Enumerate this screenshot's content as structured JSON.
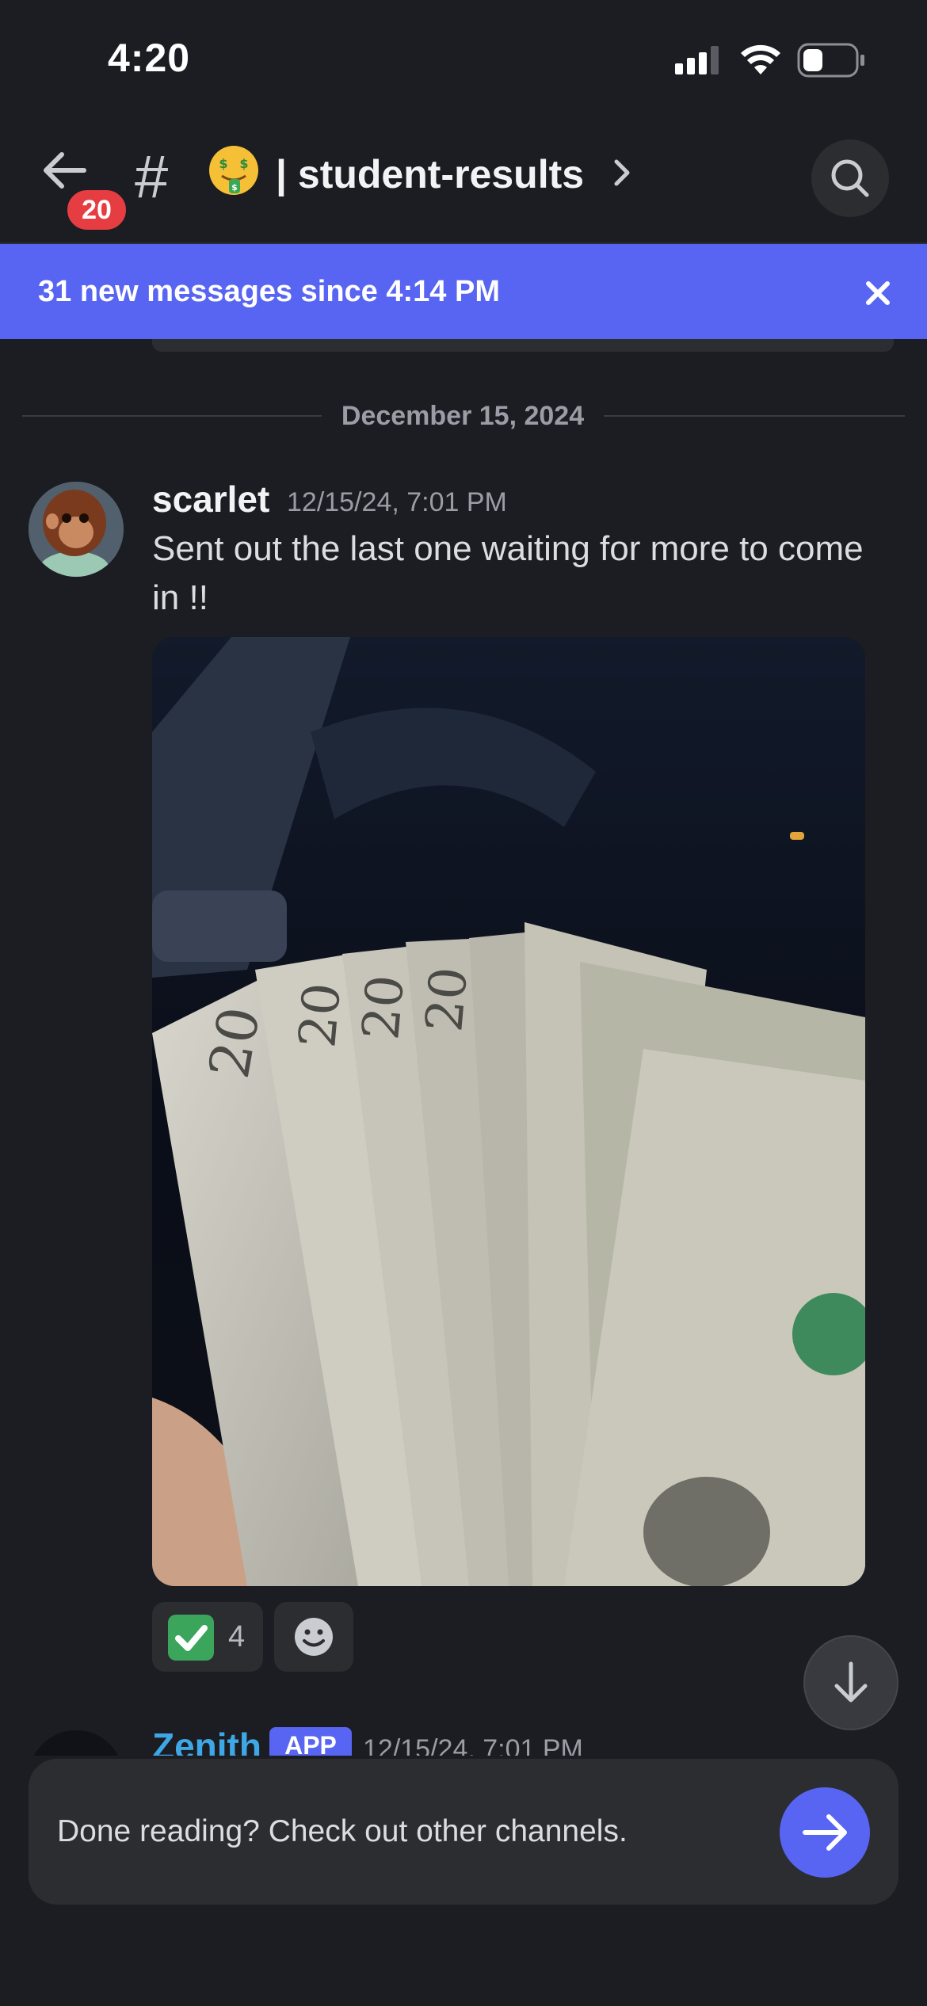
{
  "status_bar": {
    "time": "4:20",
    "icons": [
      "cellular-signal-icon",
      "wifi-icon",
      "battery-icon"
    ]
  },
  "header": {
    "back_icon": "arrow-left-icon",
    "unread_count": "20",
    "channel_icon": "hash-icon",
    "channel_emoji": "money-mouth-face-emoji",
    "channel_name": "| student-results",
    "search_icon": "search-icon"
  },
  "banner": {
    "text": "31 new messages since 4:14 PM",
    "close_icon": "close-icon",
    "color": "#5865f2"
  },
  "date_divider": "December 15, 2024",
  "message": {
    "author": "scarlet",
    "timestamp": "12/15/24, 7:01 PM",
    "text": "Sent out the last one waiting for more to come in !!",
    "attachment": "photo-of-cash-bills",
    "reactions": [
      {
        "emoji": "white-check-mark-emoji",
        "count": "4"
      }
    ],
    "add_reaction_icon": "smiley-face-icon"
  },
  "next_message": {
    "author": "Zenith",
    "badge": "APP",
    "timestamp": "12/15/24, 7:01 PM"
  },
  "jump_to_bottom_icon": "arrow-down-icon",
  "footer_prompt": {
    "text": "Done reading? Check out other channels.",
    "button_icon": "arrow-right-icon"
  }
}
